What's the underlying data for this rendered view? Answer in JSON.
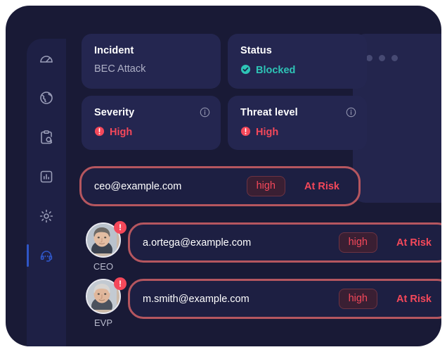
{
  "sidebar": {
    "items": [
      {
        "name": "dashboard",
        "icon": "gauge-icon",
        "active": false
      },
      {
        "name": "global",
        "icon": "globe-icon",
        "active": false
      },
      {
        "name": "investigate",
        "icon": "clipboard-search-icon",
        "active": false
      },
      {
        "name": "reports",
        "icon": "bar-chart-icon",
        "active": false
      },
      {
        "name": "settings",
        "icon": "gear-icon",
        "active": false
      },
      {
        "name": "support",
        "icon": "headset-icon",
        "active": true
      }
    ]
  },
  "overflow_menu": {
    "icon": "ellipsis-icon",
    "dots": 3
  },
  "cards": [
    {
      "title": "Incident",
      "value": "BEC Attack",
      "value_style": "muted",
      "status_icon": null,
      "info_icon": null
    },
    {
      "title": "Status",
      "value": "Blocked",
      "value_style": "ok",
      "status_icon": "check-circle-icon",
      "info_icon": null
    },
    {
      "title": "Severity",
      "value": "High",
      "value_style": "bad",
      "status_icon": "alert-circle-icon",
      "info_icon": "info-icon"
    },
    {
      "title": "Threat level",
      "value": "High",
      "value_style": "bad",
      "status_icon": "alert-circle-icon",
      "info_icon": "info-icon"
    }
  ],
  "risk_rows": [
    {
      "email": "ceo@example.com",
      "severity": "high",
      "status": "At Risk",
      "person": null,
      "indent": 0
    },
    {
      "email": "a.ortega@example.com",
      "severity": "high",
      "status": "At Risk",
      "person": {
        "role": "CEO",
        "avatar": "avatar-photo",
        "alert_badge": "!"
      },
      "indent": 1
    },
    {
      "email": "m.smith@example.com",
      "severity": "high",
      "status": "At Risk",
      "person": {
        "role": "EVP",
        "avatar": "avatar-photo",
        "alert_badge": "!"
      },
      "indent": 1
    }
  ],
  "colors": {
    "page_background": "#ffffff",
    "window_background": "#191a36",
    "sidebar_background": "#1e2045",
    "card_background": "#242650",
    "row_background": "#1d1f42",
    "danger": "#f4485a",
    "danger_border": "#b5565f",
    "success": "#2ec4b6",
    "accent_active": "#2f56c7",
    "text_primary": "#ffffff",
    "text_muted": "#aeb0c6"
  }
}
